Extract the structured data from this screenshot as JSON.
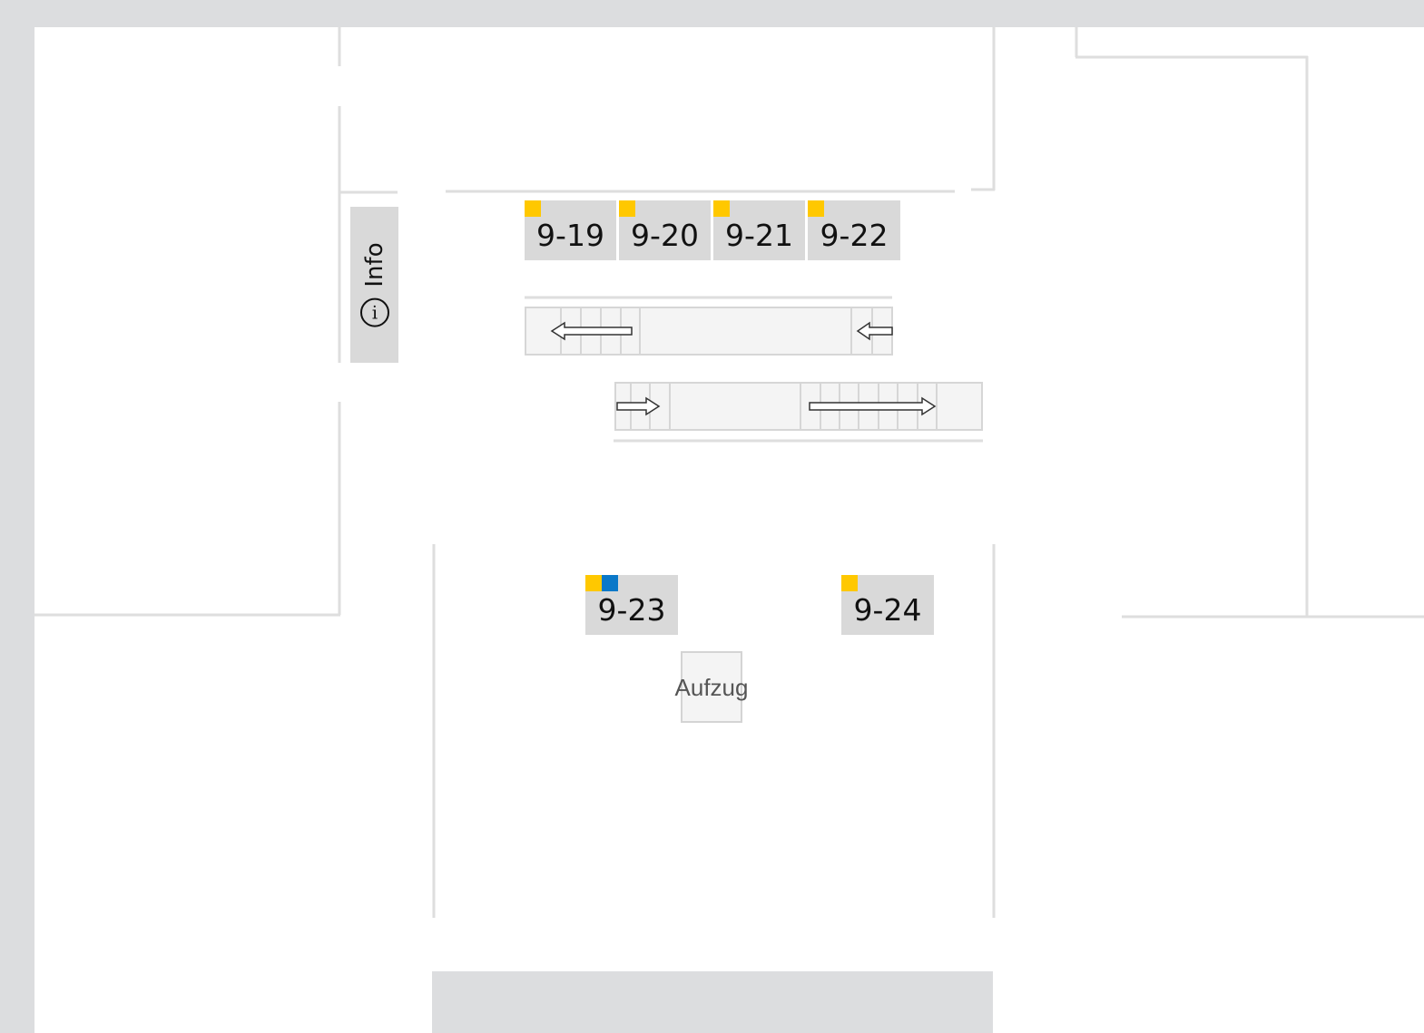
{
  "map": {
    "booths": [
      {
        "id": "9-19",
        "flags": [
          "yellow"
        ]
      },
      {
        "id": "9-20",
        "flags": [
          "yellow"
        ]
      },
      {
        "id": "9-21",
        "flags": [
          "yellow"
        ]
      },
      {
        "id": "9-22",
        "flags": [
          "yellow"
        ]
      },
      {
        "id": "9-23",
        "flags": [
          "yellow",
          "blue"
        ]
      },
      {
        "id": "9-24",
        "flags": [
          "yellow"
        ]
      }
    ],
    "info_label": "Info",
    "elevator_label": "Aufzug",
    "escalators": [
      {
        "direction": "left"
      },
      {
        "direction": "right"
      }
    ]
  },
  "colors": {
    "background": "#dcdddf",
    "floor": "#ffffff",
    "wall": "#dedede",
    "booth": "#d9d9d9",
    "flag_yellow": "#ffc800",
    "flag_blue": "#0a78c8"
  }
}
